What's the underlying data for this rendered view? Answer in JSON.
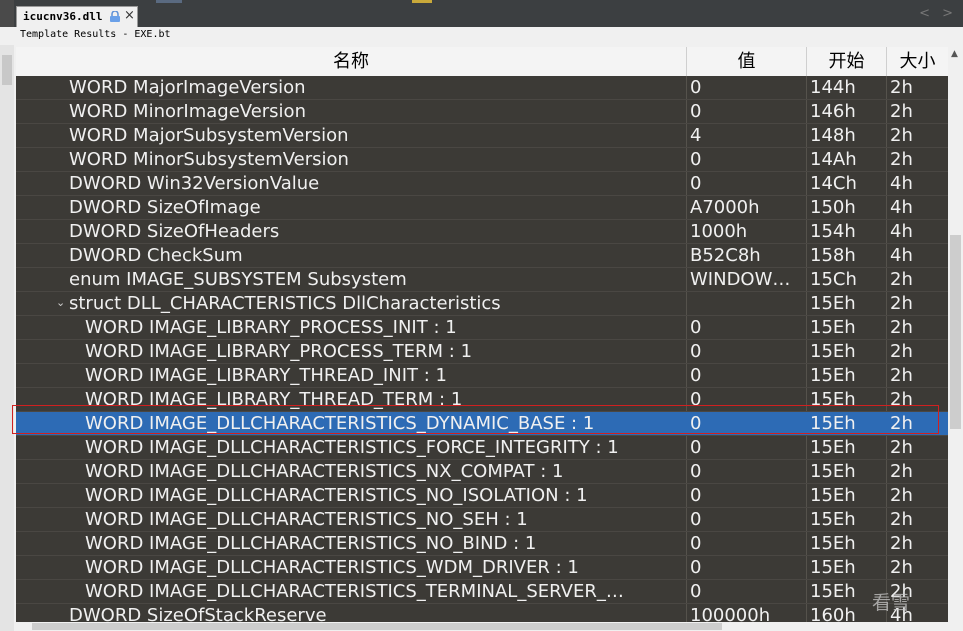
{
  "tab": {
    "label": "icucnv36.dll",
    "close_glyph": "×",
    "nav_glyphs": "< >"
  },
  "panel": {
    "title": "Template Results - EXE.bt"
  },
  "columns": {
    "name": "名称",
    "value": "值",
    "start": "开始",
    "size": "大小"
  },
  "rows": [
    {
      "name": "WORD MajorImageVersion",
      "value": "0",
      "start": "144h",
      "size": "2h",
      "indent": 1
    },
    {
      "name": "WORD MinorImageVersion",
      "value": "0",
      "start": "146h",
      "size": "2h",
      "indent": 1
    },
    {
      "name": "WORD MajorSubsystemVersion",
      "value": "4",
      "start": "148h",
      "size": "2h",
      "indent": 1
    },
    {
      "name": "WORD MinorSubsystemVersion",
      "value": "0",
      "start": "14Ah",
      "size": "2h",
      "indent": 1
    },
    {
      "name": "DWORD Win32VersionValue",
      "value": "0",
      "start": "14Ch",
      "size": "4h",
      "indent": 1
    },
    {
      "name": "DWORD SizeOfImage",
      "value": "A7000h",
      "start": "150h",
      "size": "4h",
      "indent": 1
    },
    {
      "name": "DWORD SizeOfHeaders",
      "value": "1000h",
      "start": "154h",
      "size": "4h",
      "indent": 1
    },
    {
      "name": "DWORD CheckSum",
      "value": "B52C8h",
      "start": "158h",
      "size": "4h",
      "indent": 1
    },
    {
      "name": "enum IMAGE_SUBSYSTEM Subsystem",
      "value": "WINDOW…",
      "start": "15Ch",
      "size": "2h",
      "indent": 1
    },
    {
      "name": "struct DLL_CHARACTERISTICS DllCharacteristics",
      "value": "",
      "start": "15Eh",
      "size": "2h",
      "indent": 1,
      "expanded": true
    },
    {
      "name": "WORD IMAGE_LIBRARY_PROCESS_INIT : 1",
      "value": "0",
      "start": "15Eh",
      "size": "2h",
      "indent": 2
    },
    {
      "name": "WORD IMAGE_LIBRARY_PROCESS_TERM : 1",
      "value": "0",
      "start": "15Eh",
      "size": "2h",
      "indent": 2
    },
    {
      "name": "WORD IMAGE_LIBRARY_THREAD_INIT : 1",
      "value": "0",
      "start": "15Eh",
      "size": "2h",
      "indent": 2
    },
    {
      "name": "WORD IMAGE_LIBRARY_THREAD_TERM : 1",
      "value": "0",
      "start": "15Eh",
      "size": "2h",
      "indent": 2
    },
    {
      "name": "WORD IMAGE_DLLCHARACTERISTICS_DYNAMIC_BASE : 1",
      "value": "0",
      "start": "15Eh",
      "size": "2h",
      "indent": 2,
      "selected": true
    },
    {
      "name": "WORD IMAGE_DLLCHARACTERISTICS_FORCE_INTEGRITY : 1",
      "value": "0",
      "start": "15Eh",
      "size": "2h",
      "indent": 2
    },
    {
      "name": "WORD IMAGE_DLLCHARACTERISTICS_NX_COMPAT : 1",
      "value": "0",
      "start": "15Eh",
      "size": "2h",
      "indent": 2
    },
    {
      "name": "WORD IMAGE_DLLCHARACTERISTICS_NO_ISOLATION : 1",
      "value": "0",
      "start": "15Eh",
      "size": "2h",
      "indent": 2
    },
    {
      "name": "WORD IMAGE_DLLCHARACTERISTICS_NO_SEH : 1",
      "value": "0",
      "start": "15Eh",
      "size": "2h",
      "indent": 2
    },
    {
      "name": "WORD IMAGE_DLLCHARACTERISTICS_NO_BIND : 1",
      "value": "0",
      "start": "15Eh",
      "size": "2h",
      "indent": 2
    },
    {
      "name": "WORD IMAGE_DLLCHARACTERISTICS_WDM_DRIVER : 1",
      "value": "0",
      "start": "15Eh",
      "size": "2h",
      "indent": 2
    },
    {
      "name": "WORD IMAGE_DLLCHARACTERISTICS_TERMINAL_SERVER_…",
      "value": "0",
      "start": "15Eh",
      "size": "2h",
      "indent": 2
    },
    {
      "name": "DWORD SizeOfStackReserve",
      "value": "100000h",
      "start": "160h",
      "size": "4h",
      "indent": 1
    }
  ],
  "watermark": "看雪",
  "colors": {
    "grid_bg": "#3c3a36",
    "selection": "#2d6bb5",
    "highlight_frame": "#d02020",
    "text": "#f0f0f0"
  }
}
